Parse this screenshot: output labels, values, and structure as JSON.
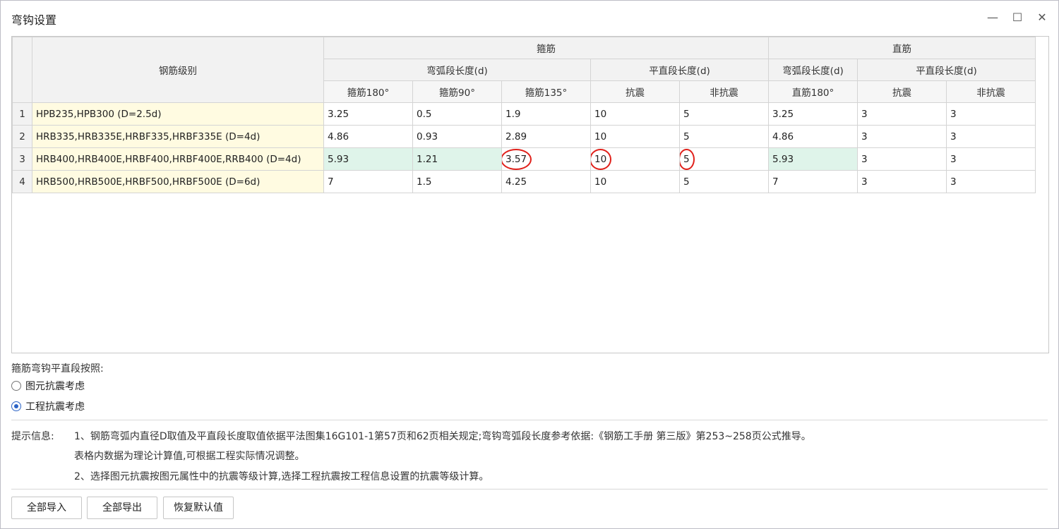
{
  "window": {
    "title": "弯钩设置",
    "minimize_glyph": "—",
    "maximize_glyph": "☐",
    "close_glyph": "✕"
  },
  "table": {
    "headers": {
      "grade": "钢筋级别",
      "stirrup_group": "箍筋",
      "straight_group": "直筋",
      "stirrup_arc": "弯弧段长度(d)",
      "stirrup_flat": "平直段长度(d)",
      "straight_arc": "弯弧段长度(d)",
      "straight_flat": "平直段长度(d)",
      "c180": "箍筋180°",
      "c90": "箍筋90°",
      "c135": "箍筋135°",
      "seismic": "抗震",
      "nonseismic": "非抗震",
      "straight180": "直筋180°",
      "seismic2": "抗震",
      "nonseismic2": "非抗震"
    },
    "rows": [
      {
        "num": "1",
        "grade": "HPB235,HPB300 (D=2.5d)",
        "c180": "3.25",
        "c90": "0.5",
        "c135": "1.9",
        "seismic": "10",
        "nonseismic": "5",
        "straight180": "3.25",
        "seismic2": "3",
        "nonseismic2": "3"
      },
      {
        "num": "2",
        "grade": "HRB335,HRB335E,HRBF335,HRBF335E (D=4d)",
        "c180": "4.86",
        "c90": "0.93",
        "c135": "2.89",
        "seismic": "10",
        "nonseismic": "5",
        "straight180": "4.86",
        "seismic2": "3",
        "nonseismic2": "3"
      },
      {
        "num": "3",
        "grade": "HRB400,HRB400E,HRBF400,HRBF400E,RRB400 (D=4d)",
        "c180": "5.93",
        "c90": "1.21",
        "c135": "3.57",
        "seismic": "10",
        "nonseismic": "5",
        "straight180": "5.93",
        "seismic2": "3",
        "nonseismic2": "3"
      },
      {
        "num": "4",
        "grade": "HRB500,HRB500E,HRBF500,HRBF500E (D=6d)",
        "c180": "7",
        "c90": "1.5",
        "c135": "4.25",
        "seismic": "10",
        "nonseismic": "5",
        "straight180": "7",
        "seismic2": "3",
        "nonseismic2": "3"
      }
    ]
  },
  "options": {
    "label": "箍筋弯钩平直段按照:",
    "radio1": "图元抗震考虑",
    "radio2": "工程抗震考虑",
    "selected": "工程抗震考虑"
  },
  "hints": {
    "label": "提示信息:",
    "line1": "1、钢筋弯弧内直径D取值及平直段长度取值依据平法图集16G101-1第57页和62页相关规定;弯钩弯弧段长度参考依据:《钢筋工手册 第三版》第253~258页公式推导。",
    "line2": "表格内数据为理论计算值,可根据工程实际情况调整。",
    "line3": "2、选择图元抗震按图元属性中的抗震等级计算,选择工程抗震按工程信息设置的抗震等级计算。"
  },
  "buttons": {
    "import_all": "全部导入",
    "export_all": "全部导出",
    "restore_default": "恢复默认值"
  },
  "colors": {
    "grade_cell_bg": "#fffbe1",
    "selected_row_highlight": "#dff4ea",
    "annotation_circle": "#e0201a",
    "radio_accent": "#2b63c6"
  }
}
